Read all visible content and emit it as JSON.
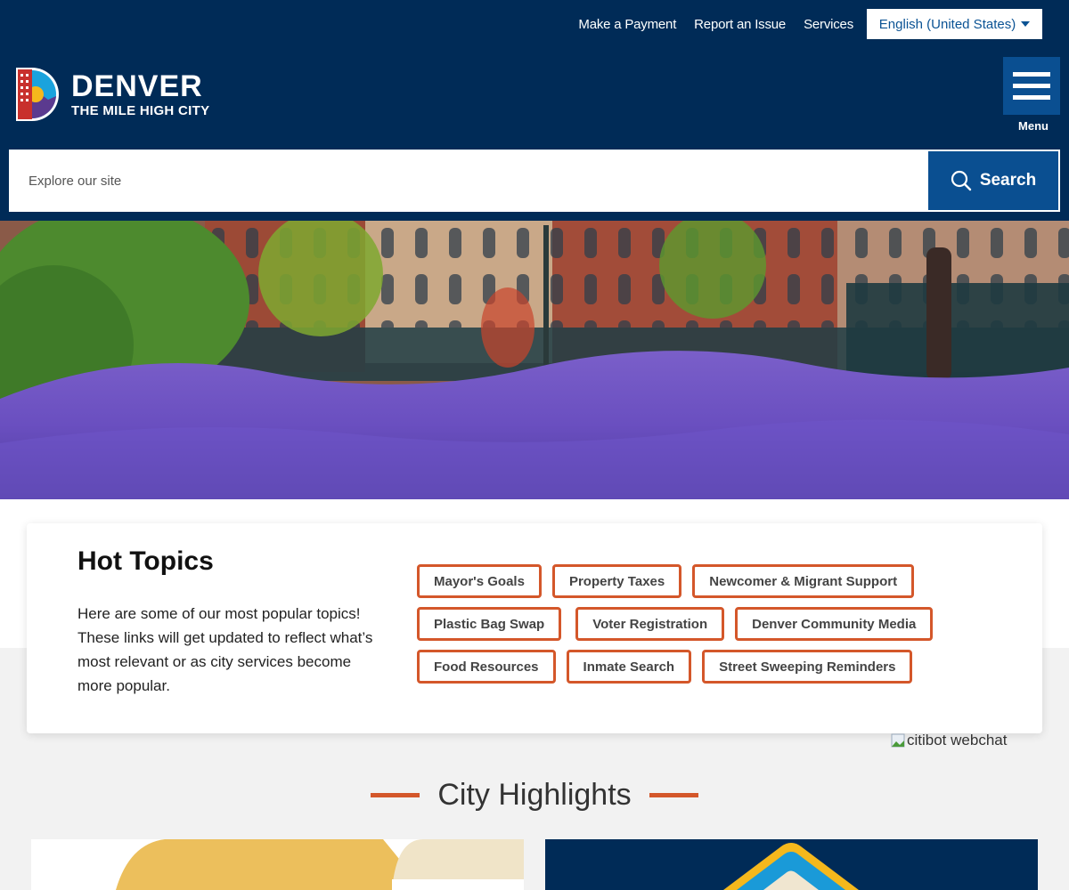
{
  "utility_nav": {
    "links": [
      "Make a Payment",
      "Report an Issue",
      "Services"
    ],
    "language": "English (United States)"
  },
  "logo": {
    "title": "DENVER",
    "tagline": "THE MILE HIGH CITY"
  },
  "menu": {
    "label": "Menu"
  },
  "search": {
    "placeholder": "Explore our site",
    "value": "",
    "button_label": "Search"
  },
  "hero": {
    "description": "Street scene with brick buildings and purple flowers"
  },
  "hot_topics": {
    "title": "Hot Topics",
    "description": "Here are some of our most popular topics! These links will get updated to reflect what’s most relevant or as city services become more popular.",
    "rows": [
      [
        "Mayor's Goals",
        "Property Taxes",
        "Newcomer & Migrant Support"
      ],
      [
        "Plastic Bag Swap",
        "Voter Registration",
        "Denver Community Media"
      ],
      [
        "Food Resources",
        "Inmate Search",
        "Street Sweeping Reminders"
      ]
    ]
  },
  "citibot": {
    "alt": "citibot webchat"
  },
  "highlights": {
    "title": "City Highlights"
  },
  "colors": {
    "navy": "#002b57",
    "blue": "#0a4f91",
    "orange": "#d4572a"
  }
}
